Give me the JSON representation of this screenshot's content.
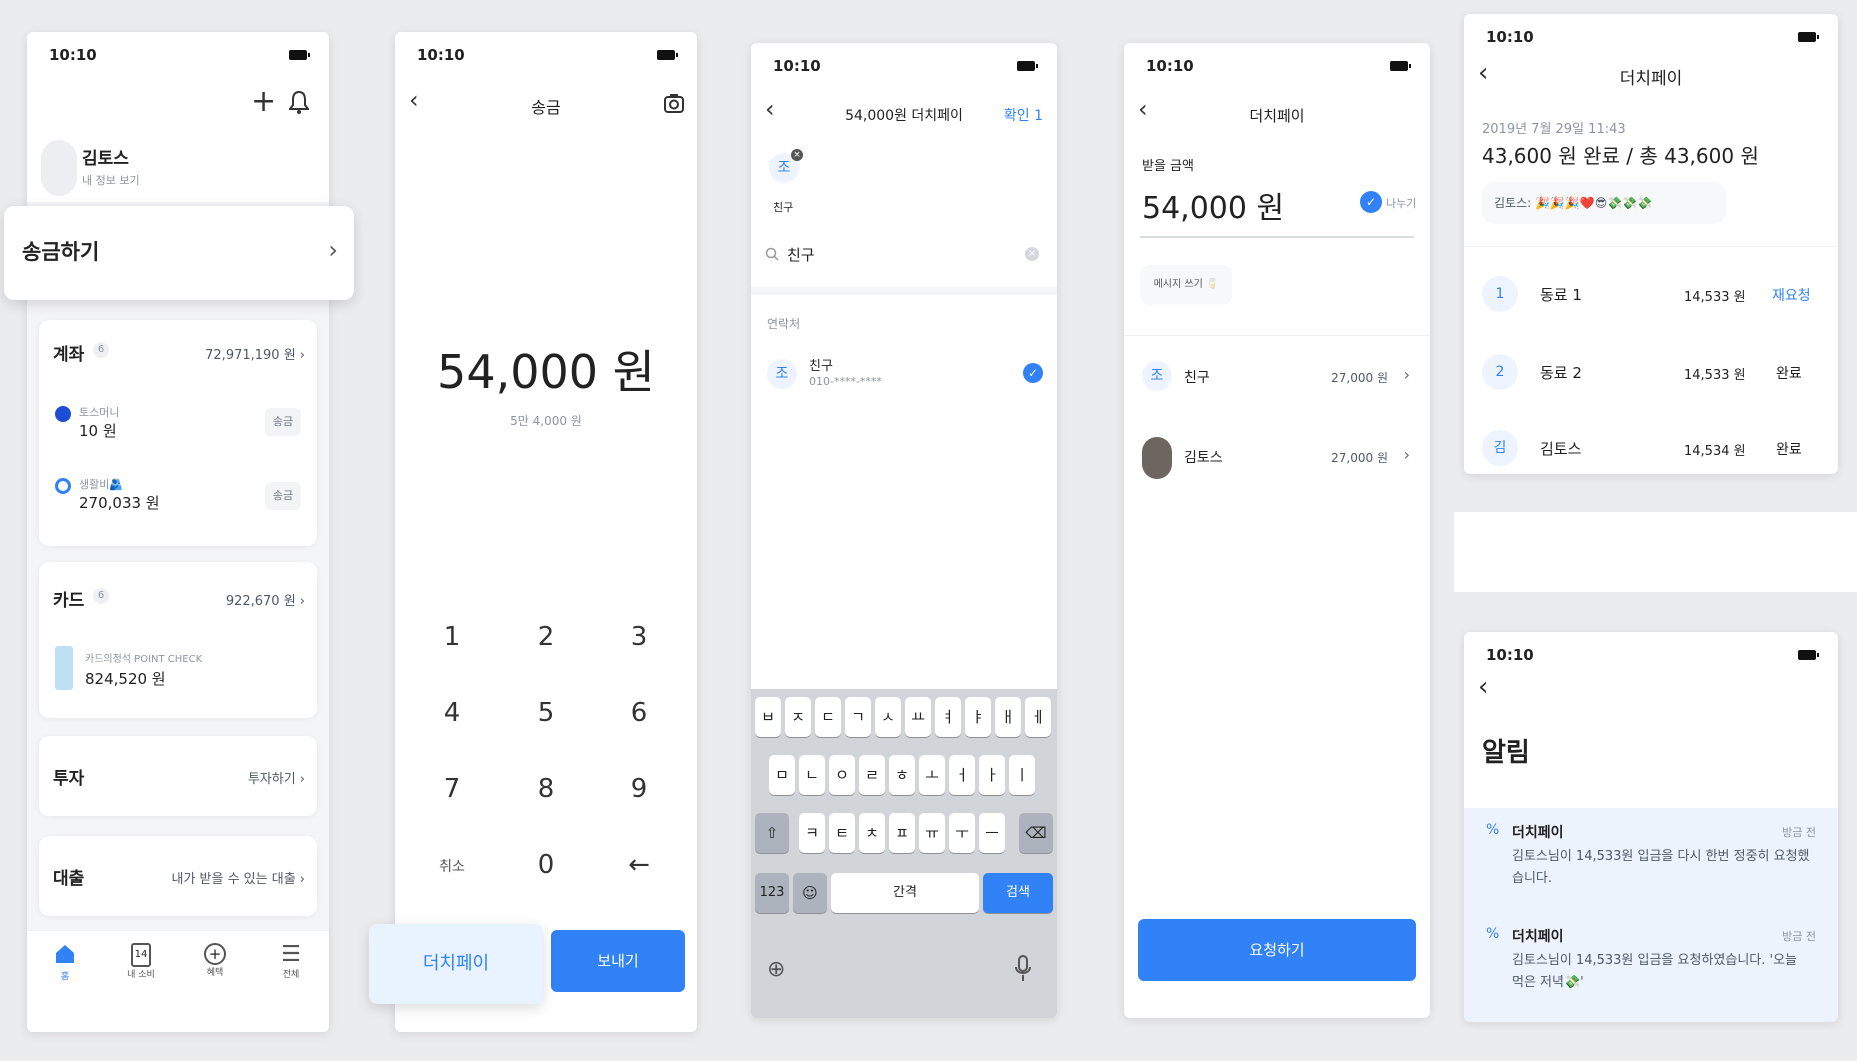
{
  "status_time": "10:10",
  "home": {
    "user_name": "김토스",
    "user_sub": "내 정보 보기",
    "send_banner": "송금하기",
    "account": {
      "title": "계좌",
      "count": "6",
      "total": "72,971,190 원 ›",
      "items": [
        {
          "name": "토스머니",
          "amount": "10 원",
          "btn": "송금"
        },
        {
          "name": "생활비🫂",
          "amount": "270,033 원",
          "btn": "송금"
        }
      ]
    },
    "card": {
      "title": "카드",
      "count": "6",
      "total": "922,670 원 ›",
      "item_name": "카드의정석 POINT CHECK",
      "item_amount": "824,520 원"
    },
    "invest": {
      "title": "투자",
      "link": "투자하기 ›"
    },
    "loan": {
      "title": "대출",
      "link": "내가 받을 수 있는 대출 ›"
    },
    "nav": [
      "홈",
      "내 소비",
      "혜택",
      "전체"
    ],
    "nav_cal_num": "14"
  },
  "transfer": {
    "title": "송금",
    "amount": "54,000 원",
    "amount_sub": "5만 4,000 원",
    "keys": [
      "1",
      "2",
      "3",
      "4",
      "5",
      "6",
      "7",
      "8",
      "9",
      "취소",
      "0",
      "←"
    ],
    "dutch_btn": "더치페이",
    "send_btn": "보내기"
  },
  "dutch_select": {
    "title": "54,000원 더치페이",
    "confirm": "확인 1",
    "chip_avatar": "조",
    "chip_label": "친구",
    "search_value": "친구",
    "section": "연락처",
    "contact_avatar": "조",
    "contact_name": "친구",
    "contact_phone": "010-****-****",
    "kb_row1": [
      "ㅂ",
      "ㅈ",
      "ㄷ",
      "ㄱ",
      "ㅅ",
      "ㅛ",
      "ㅕ",
      "ㅑ",
      "ㅐ",
      "ㅔ"
    ],
    "kb_row2": [
      "ㅁ",
      "ㄴ",
      "ㅇ",
      "ㄹ",
      "ㅎ",
      "ㅗ",
      "ㅓ",
      "ㅏ",
      "ㅣ"
    ],
    "kb_row3": [
      "ㅋ",
      "ㅌ",
      "ㅊ",
      "ㅍ",
      "ㅠ",
      "ㅜ",
      "ㅡ"
    ],
    "kb_123": "123",
    "kb_space": "간격",
    "kb_search": "검색"
  },
  "dutch_pay": {
    "title": "더치페이",
    "receive_label": "받을 금액",
    "amount": "54,000 원",
    "split_label": "나누기",
    "message_btn": "메시지 쓰기 🥛",
    "rows": [
      {
        "avatar": "조",
        "name": "친구",
        "amount": "27,000 원"
      },
      {
        "avatar": "",
        "name": "김토스",
        "amount": "27,000 원"
      }
    ],
    "request_btn": "요청하기"
  },
  "dutch_status": {
    "title": "더치페이",
    "date": "2019년 7월 29일 11:43",
    "summary": "43,600 원 완료 / 총 43,600 원",
    "chat": "김토스: 🎉🎉🎉❤️😎💸💸💸",
    "rows": [
      {
        "num": "1",
        "name": "동료 1",
        "amount": "14,533 원",
        "status": "재요청"
      },
      {
        "num": "2",
        "name": "동료 2",
        "amount": "14,533 원",
        "status": "완료"
      },
      {
        "num": "김",
        "name": "김토스",
        "amount": "14,534 원",
        "status": "완료"
      }
    ]
  },
  "notifications": {
    "title": "알림",
    "items": [
      {
        "app": "더치페이",
        "time": "방금 전",
        "text": "김토스님이 14,533원 입금을 다시 한번 정중히 요청했습니다."
      },
      {
        "app": "더치페이",
        "time": "방금 전",
        "text": "김토스님이 14,533원 입금을 요청하였습니다. '오늘 먹은 저녁💸'"
      }
    ]
  }
}
